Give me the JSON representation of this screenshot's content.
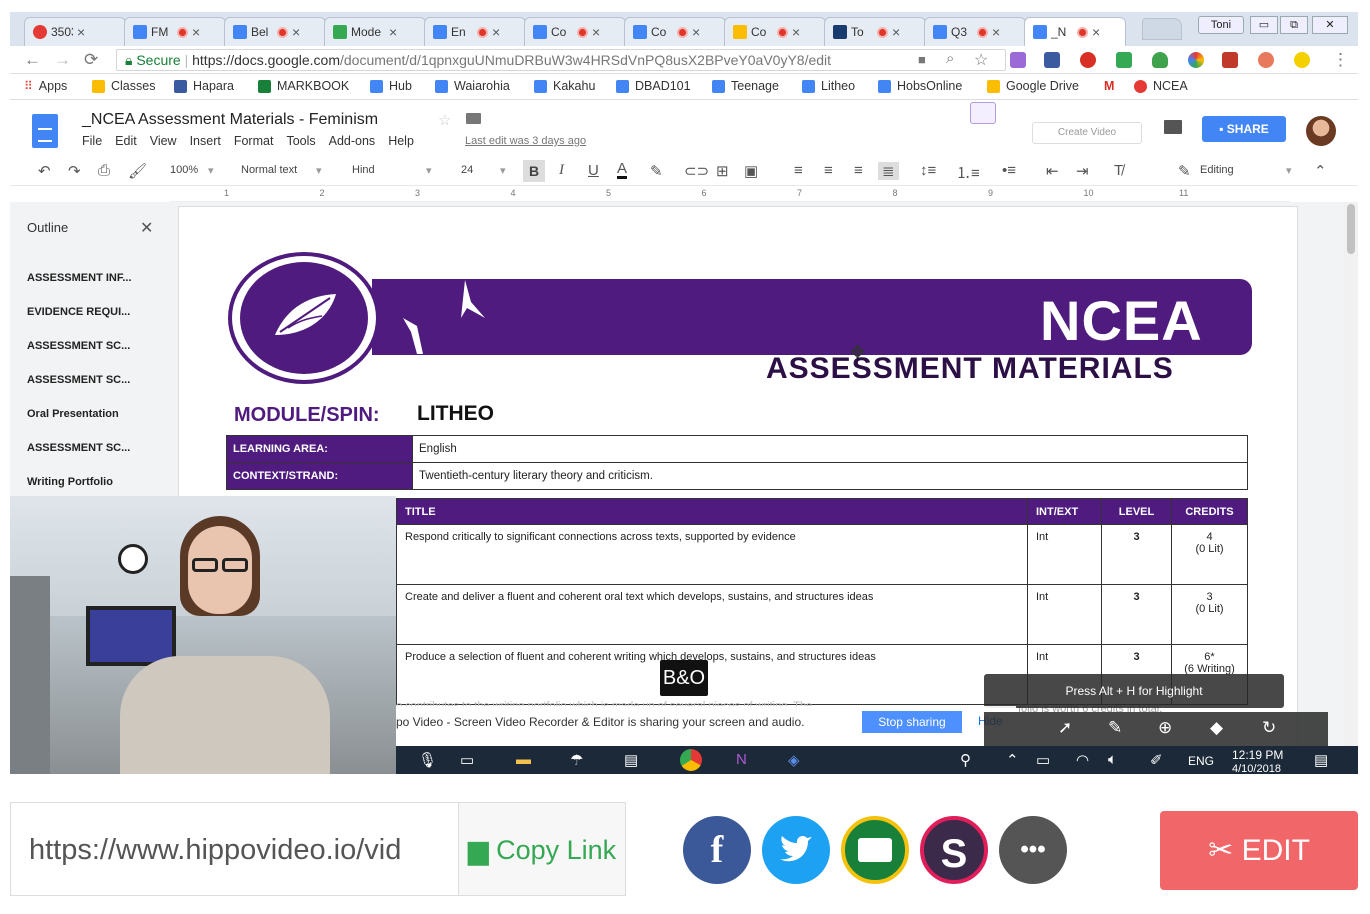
{
  "browser": {
    "tabs": [
      {
        "label": "3503",
        "favicon_color": "#e53935",
        "active": false
      },
      {
        "label": "FM",
        "favicon_color": "#4285f4",
        "active": false
      },
      {
        "label": "Bel",
        "favicon_color": "#4285f4",
        "active": false
      },
      {
        "label": "Mode",
        "favicon_color": "#34a853",
        "active": false
      },
      {
        "label": "En",
        "favicon_color": "#4285f4",
        "active": false
      },
      {
        "label": "Co",
        "favicon_color": "#4285f4",
        "active": false
      },
      {
        "label": "Co",
        "favicon_color": "#4285f4",
        "active": false
      },
      {
        "label": "Co",
        "favicon_color": "#fbbc04",
        "active": false
      },
      {
        "label": "To",
        "favicon_color": "#1a3b6e",
        "active": false
      },
      {
        "label": "Q3",
        "favicon_color": "#4285f4",
        "active": false
      },
      {
        "label": "_N",
        "favicon_color": "#4285f4",
        "active": true
      }
    ],
    "user_label": "Toni",
    "url_secure": "Secure",
    "url_host": "https://docs.google.com",
    "url_path": "/document/d/1qpnxguUNmuDRBuW3w4HRSdVnPQ8usX2BPveY0aV0yY8/edit",
    "bookmarks": [
      {
        "label": "Apps",
        "color": "#e53935"
      },
      {
        "label": "Classes",
        "color": "#fbbc04"
      },
      {
        "label": "Hapara",
        "color": "#3a5ba0"
      },
      {
        "label": "MARKBOOK",
        "color": "#188038"
      },
      {
        "label": "Hub",
        "color": "#4285f4"
      },
      {
        "label": "Waiarohia",
        "color": "#4285f4"
      },
      {
        "label": "Kakahu",
        "color": "#4285f4"
      },
      {
        "label": "DBAD101",
        "color": "#4285f4"
      },
      {
        "label": "Teenage",
        "color": "#4285f4"
      },
      {
        "label": "Litheo",
        "color": "#4285f4"
      },
      {
        "label": "HobsOnline",
        "color": "#4285f4"
      },
      {
        "label": "Google Drive",
        "color": "#fbbc04"
      },
      {
        "label": "M",
        "color": "#d93025"
      },
      {
        "label": "NCEA",
        "color": "#e53935"
      }
    ]
  },
  "docs": {
    "title": "_NCEA Assessment Materials - Feminism",
    "menus": [
      "File",
      "Edit",
      "View",
      "Insert",
      "Format",
      "Tools",
      "Add-ons",
      "Help"
    ],
    "last_edit": "Last edit was 3 days ago",
    "create_video": "Create Video",
    "share": "SHARE",
    "toolbar": {
      "zoom": "100%",
      "style": "Normal text",
      "font": "Hind",
      "size": "24",
      "bold": "B",
      "italic": "I",
      "underline": "U",
      "text_color": "A",
      "mode": "Editing"
    },
    "outline": {
      "title": "Outline",
      "items": [
        "ASSESSMENT INF...",
        "EVIDENCE REQUI...",
        "ASSESSMENT SC...",
        "ASSESSMENT SC...",
        "Oral Presentation",
        "ASSESSMENT SC...",
        "Writing Portfolio"
      ]
    }
  },
  "document": {
    "banner_big": "NCEA",
    "banner_sub": "ASSESSMENT MATERIALS",
    "module_label": "MODULE/SPIN:",
    "module_value": "LITHEO",
    "info": [
      {
        "label": "LEARNING AREA:",
        "value": "English"
      },
      {
        "label": "CONTEXT/STRAND:",
        "value": "Twentieth-century literary theory and criticism."
      }
    ],
    "standards_headers": [
      "TITLE",
      "INT/EXT",
      "LEVEL",
      "CREDITS"
    ],
    "standards": [
      {
        "title": "Respond critically to significant connections across texts, supported by evidence",
        "intext": "Int",
        "level": "3",
        "credits": "4",
        "credits_note": "(0 Lit)"
      },
      {
        "title": "Create and deliver a fluent and coherent oral text which develops, sustains, and structures ideas",
        "intext": "Int",
        "level": "3",
        "credits": "3",
        "credits_note": "(0 Lit)"
      },
      {
        "title": "Produce a selection of fluent and coherent writing which develops, sustains, and structures ideas",
        "intext": "Int",
        "level": "3",
        "credits": "6*",
        "credits_note": "(6 Writing)"
      }
    ],
    "footnote_left": "o contributes to the writing portfolio which is made up of several pieces of writing. The",
    "footnote_right": "folio is worth 6 credits in total."
  },
  "overlay": {
    "share_text": "po Video - Screen Video Recorder & Editor is sharing your screen and audio.",
    "stop_sharing": "Stop sharing",
    "hide": "Hide",
    "highlight_hint": "Press Alt + H for Highlight",
    "bo_logo": "B&O"
  },
  "taskbar": {
    "time": "12:19 PM",
    "date": "4/10/2018",
    "lang": "ENG"
  },
  "footer": {
    "link": "https://www.hippovideo.io/vid",
    "copy_link": "Copy Link",
    "edit": "EDIT",
    "socials": [
      {
        "name": "facebook",
        "glyph": "f",
        "color": "#3b5998"
      },
      {
        "name": "twitter",
        "glyph": "t",
        "color": "#1da1f2"
      },
      {
        "name": "google-classroom",
        "glyph": "c",
        "color": "#188038"
      },
      {
        "name": "slack",
        "glyph": "S",
        "color": "#3c2a4a"
      },
      {
        "name": "more",
        "glyph": "•••",
        "color": "#555555"
      }
    ]
  }
}
